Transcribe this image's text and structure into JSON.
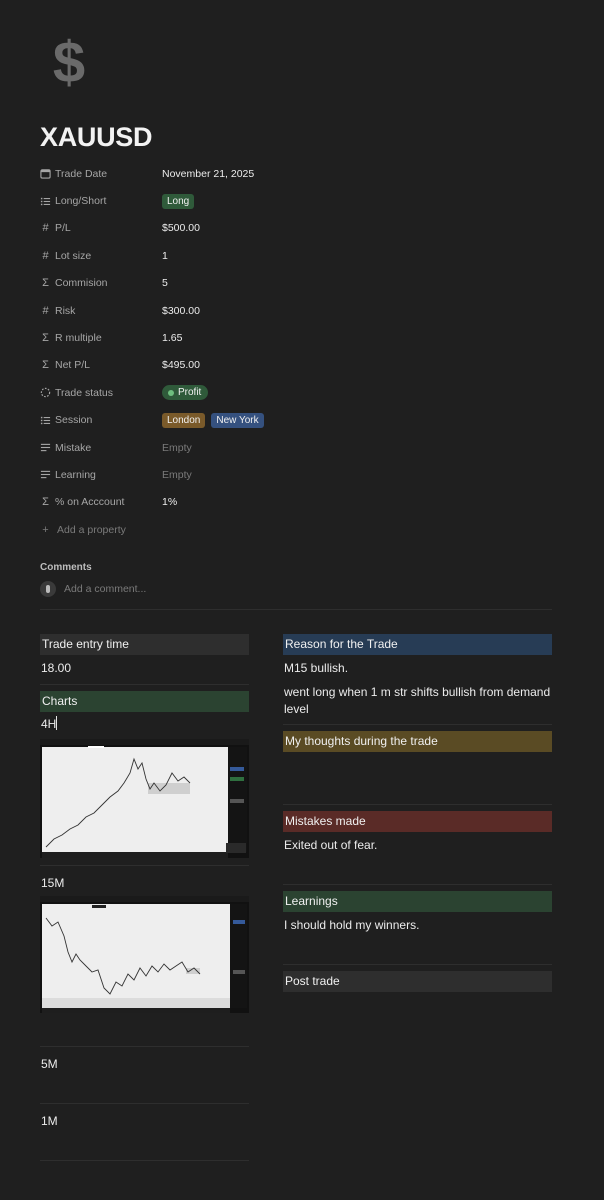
{
  "page": {
    "icon": "dollar-sign-icon",
    "title": "XAUUSD"
  },
  "properties": [
    {
      "icon": "calendar-icon",
      "label": "Trade Date",
      "value": "November 21, 2025",
      "kind": "text"
    },
    {
      "icon": "list-icon",
      "label": "Long/Short",
      "tags": [
        "Long"
      ],
      "kind": "tags"
    },
    {
      "icon": "hash-icon",
      "label": "P/L",
      "value": "$500.00",
      "kind": "text"
    },
    {
      "icon": "hash-icon",
      "label": "Lot size",
      "value": "1",
      "kind": "text"
    },
    {
      "icon": "sigma-icon",
      "label": "Commision",
      "value": "5",
      "kind": "text"
    },
    {
      "icon": "hash-icon",
      "label": "Risk",
      "value": "$300.00",
      "kind": "text"
    },
    {
      "icon": "sigma-icon",
      "label": "R multiple",
      "value": "1.65",
      "kind": "text"
    },
    {
      "icon": "sigma-icon",
      "label": "Net P/L",
      "value": "$495.00",
      "kind": "text"
    },
    {
      "icon": "status-icon",
      "label": "Trade status",
      "value": "Profit",
      "kind": "status"
    },
    {
      "icon": "list-icon",
      "label": "Session",
      "tags": [
        "London",
        "New York"
      ],
      "kind": "tags"
    },
    {
      "icon": "text-lines-icon",
      "label": "Mistake",
      "value": "Empty",
      "kind": "empty"
    },
    {
      "icon": "text-lines-icon",
      "label": "Learning",
      "value": "Empty",
      "kind": "empty"
    },
    {
      "icon": "sigma-icon",
      "label": "% on Acccount",
      "value": "1%",
      "kind": "text"
    }
  ],
  "add_property_label": "Add a property",
  "comments": {
    "title": "Comments",
    "placeholder": "Add a comment..."
  },
  "left_column": {
    "entry_header": "Trade entry time",
    "entry_value": "18.00",
    "charts_header": "Charts",
    "tf_4h": "4H",
    "tf_15m": "15M",
    "tf_5m": "5M",
    "tf_1m": "1M"
  },
  "right_column": {
    "reason_header": "Reason for the Trade",
    "reason_line1": "M15 bullish.",
    "reason_line2": "went long when 1 m str shifts bullish from demand level",
    "thoughts_header": "My thoughts during the trade",
    "mistakes_header": "Mistakes made",
    "mistakes_text": "Exited out of fear.",
    "learnings_header": "Learnings",
    "learnings_text": "I should hold my winners.",
    "post_header": "Post trade"
  },
  "colors": {
    "background": "#1f1f1f",
    "tag_green": "#2f5a3a",
    "tag_brown": "#7a5a2a",
    "tag_blue": "#35517f"
  }
}
